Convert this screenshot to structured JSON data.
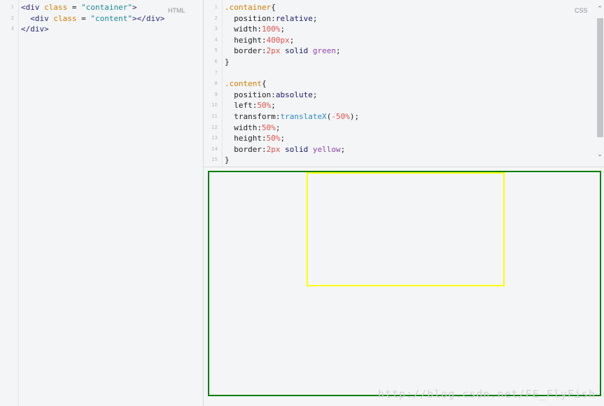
{
  "html_panel": {
    "label": "HTML",
    "line_numbers": [
      "1",
      "2",
      "3"
    ],
    "lines": [
      [
        {
          "t": "<div ",
          "c": "tag"
        },
        {
          "t": "class",
          "c": "attr"
        },
        {
          "t": " = ",
          "c": "punc"
        },
        {
          "t": "\"container\"",
          "c": "str"
        },
        {
          "t": ">",
          "c": "tag"
        }
      ],
      [
        {
          "t": "  <div ",
          "c": "tag"
        },
        {
          "t": "class",
          "c": "attr"
        },
        {
          "t": " = ",
          "c": "punc"
        },
        {
          "t": "\"content\"",
          "c": "str"
        },
        {
          "t": "></div>",
          "c": "tag"
        }
      ],
      [
        {
          "t": "</div>",
          "c": "tag"
        }
      ]
    ]
  },
  "css_panel": {
    "label": "CSS",
    "line_numbers": [
      "1",
      "2",
      "3",
      "4",
      "5",
      "6",
      "7",
      "8",
      "9",
      "10",
      "11",
      "12",
      "13",
      "14",
      "15"
    ],
    "lines": [
      [
        {
          "t": ".container",
          "c": "sel"
        },
        {
          "t": "{",
          "c": "punc"
        }
      ],
      [
        {
          "t": "  position",
          "c": "prop"
        },
        {
          "t": ":",
          "c": "punc"
        },
        {
          "t": "relative",
          "c": "kw"
        },
        {
          "t": ";",
          "c": "punc"
        }
      ],
      [
        {
          "t": "  width",
          "c": "prop"
        },
        {
          "t": ":",
          "c": "punc"
        },
        {
          "t": "100%",
          "c": "num"
        },
        {
          "t": ";",
          "c": "punc"
        }
      ],
      [
        {
          "t": "  height",
          "c": "prop"
        },
        {
          "t": ":",
          "c": "punc"
        },
        {
          "t": "400px",
          "c": "num"
        },
        {
          "t": ";",
          "c": "punc"
        }
      ],
      [
        {
          "t": "  border",
          "c": "prop"
        },
        {
          "t": ":",
          "c": "punc"
        },
        {
          "t": "2px",
          "c": "num"
        },
        {
          "t": " solid ",
          "c": "kw"
        },
        {
          "t": "green",
          "c": "col"
        },
        {
          "t": ";",
          "c": "punc"
        }
      ],
      [
        {
          "t": "}",
          "c": "punc"
        }
      ],
      [],
      [
        {
          "t": ".content",
          "c": "sel"
        },
        {
          "t": "{",
          "c": "punc"
        }
      ],
      [
        {
          "t": "  position",
          "c": "prop"
        },
        {
          "t": ":",
          "c": "punc"
        },
        {
          "t": "absolute",
          "c": "kw"
        },
        {
          "t": ";",
          "c": "punc"
        }
      ],
      [
        {
          "t": "  left",
          "c": "prop"
        },
        {
          "t": ":",
          "c": "punc"
        },
        {
          "t": "50%",
          "c": "num"
        },
        {
          "t": ";",
          "c": "punc"
        }
      ],
      [
        {
          "t": "  transform",
          "c": "prop"
        },
        {
          "t": ":",
          "c": "punc"
        },
        {
          "t": "translateX",
          "c": "fn"
        },
        {
          "t": "(",
          "c": "punc"
        },
        {
          "t": "-50%",
          "c": "num"
        },
        {
          "t": ");",
          "c": "punc"
        }
      ],
      [
        {
          "t": "  width",
          "c": "prop"
        },
        {
          "t": ":",
          "c": "punc"
        },
        {
          "t": "50%",
          "c": "num"
        },
        {
          "t": ";",
          "c": "punc"
        }
      ],
      [
        {
          "t": "  height",
          "c": "prop"
        },
        {
          "t": ":",
          "c": "punc"
        },
        {
          "t": "50%",
          "c": "num"
        },
        {
          "t": ";",
          "c": "punc"
        }
      ],
      [
        {
          "t": "  border",
          "c": "prop"
        },
        {
          "t": ":",
          "c": "punc"
        },
        {
          "t": "2px",
          "c": "num"
        },
        {
          "t": " solid ",
          "c": "kw"
        },
        {
          "t": "yellow",
          "c": "col"
        },
        {
          "t": ";",
          "c": "punc"
        }
      ],
      [
        {
          "t": "}",
          "c": "punc"
        }
      ]
    ]
  },
  "scrollbar": {
    "up_icon": "chevron-up-icon",
    "down_icon": "chevron-down-icon"
  },
  "result": {
    "watermark": "http://blog.csdn.net/FE_FlyFish",
    "container_border_color": "#008000",
    "content_border_color": "#ffff00"
  }
}
